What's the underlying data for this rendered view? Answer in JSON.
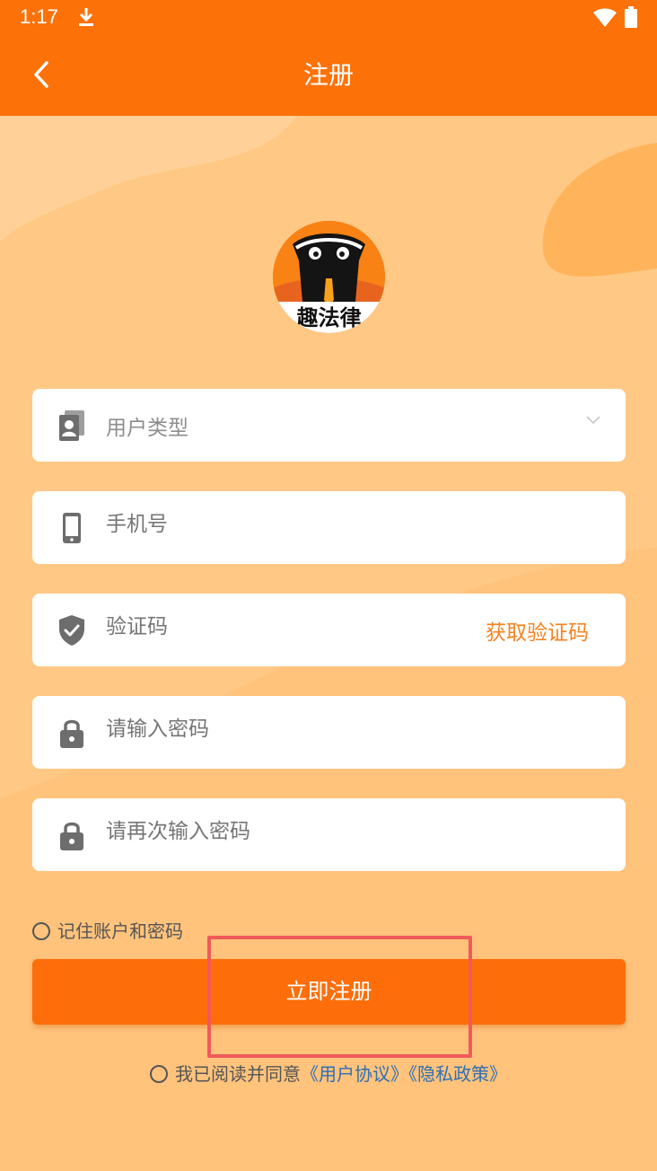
{
  "status_bar": {
    "time": "1:17"
  },
  "app_bar": {
    "title": "注册"
  },
  "logo": {
    "text": "趣法律"
  },
  "form": {
    "user_type": {
      "placeholder": "用户类型"
    },
    "phone": {
      "placeholder": "手机号"
    },
    "code": {
      "placeholder": "验证码",
      "action_label": "获取验证码"
    },
    "password": {
      "placeholder": "请输入密码"
    },
    "confirm_password": {
      "placeholder": "请再次输入密码"
    }
  },
  "remember_label": "记住账户和密码",
  "register_button_label": "立即注册",
  "agreement": {
    "prefix": "我已阅读并同意",
    "user_agreement": "《用户协议》",
    "privacy_policy": "《隐私政策》"
  },
  "colors": {
    "primary": "#fd7208",
    "background": "#ffc985",
    "link": "#2f6fb3",
    "accent_text": "#f6821f"
  }
}
